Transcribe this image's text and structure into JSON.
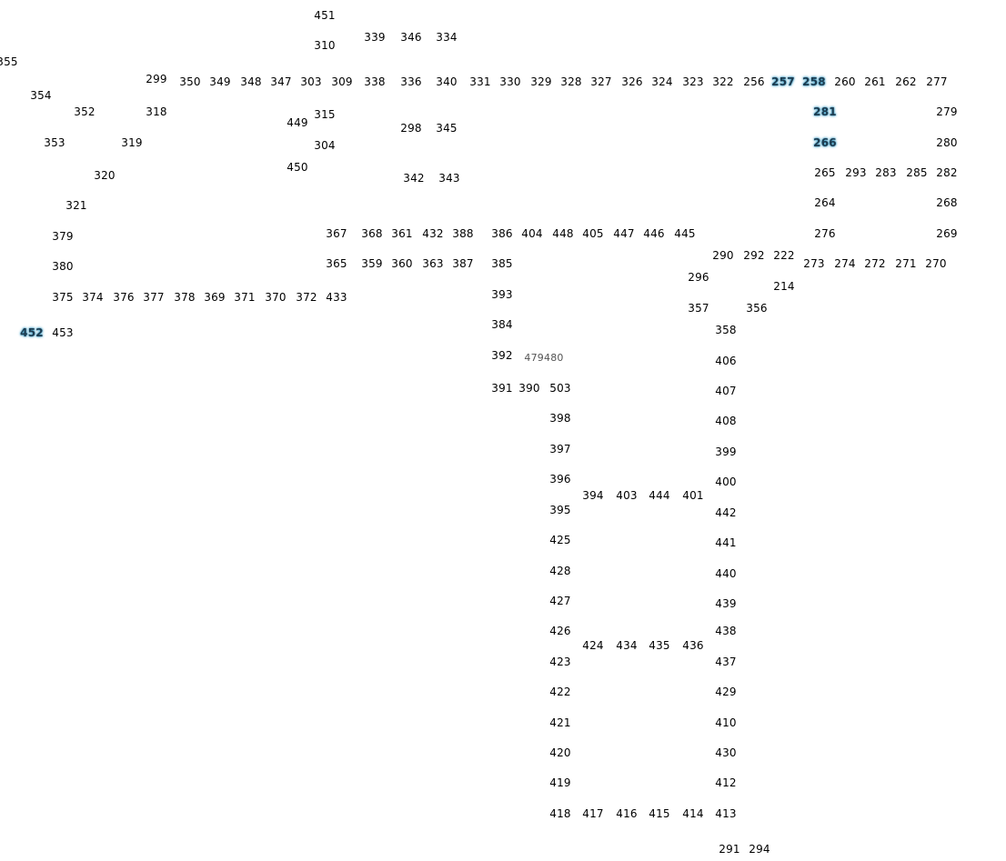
{
  "colors": {
    "label": "#000000",
    "highlight_text": "#1d3b4f",
    "highlight_glow": "#4aa3c8",
    "background": "#ffffff"
  },
  "nodes": [
    {
      "id": "451"
    },
    {
      "id": "310"
    },
    {
      "id": "339"
    },
    {
      "id": "346"
    },
    {
      "id": "334"
    },
    {
      "id": "355"
    },
    {
      "id": "354"
    },
    {
      "id": "299"
    },
    {
      "id": "350"
    },
    {
      "id": "349"
    },
    {
      "id": "348"
    },
    {
      "id": "347"
    },
    {
      "id": "303"
    },
    {
      "id": "309"
    },
    {
      "id": "338"
    },
    {
      "id": "336"
    },
    {
      "id": "340"
    },
    {
      "id": "331"
    },
    {
      "id": "330"
    },
    {
      "id": "329"
    },
    {
      "id": "328"
    },
    {
      "id": "327"
    },
    {
      "id": "326"
    },
    {
      "id": "324"
    },
    {
      "id": "323"
    },
    {
      "id": "322"
    },
    {
      "id": "256"
    },
    {
      "id": "257",
      "highlighted": true
    },
    {
      "id": "258",
      "highlighted": true
    },
    {
      "id": "260"
    },
    {
      "id": "261"
    },
    {
      "id": "262"
    },
    {
      "id": "277"
    },
    {
      "id": "352"
    },
    {
      "id": "318"
    },
    {
      "id": "315"
    },
    {
      "id": "449"
    },
    {
      "id": "281",
      "highlighted": true
    },
    {
      "id": "279"
    },
    {
      "id": "298"
    },
    {
      "id": "345"
    },
    {
      "id": "353"
    },
    {
      "id": "319"
    },
    {
      "id": "304"
    },
    {
      "id": "266",
      "highlighted": true
    },
    {
      "id": "280"
    },
    {
      "id": "450"
    },
    {
      "id": "320"
    },
    {
      "id": "342"
    },
    {
      "id": "343"
    },
    {
      "id": "265"
    },
    {
      "id": "293"
    },
    {
      "id": "283"
    },
    {
      "id": "285"
    },
    {
      "id": "282"
    },
    {
      "id": "321"
    },
    {
      "id": "264"
    },
    {
      "id": "268"
    },
    {
      "id": "379"
    },
    {
      "id": "367"
    },
    {
      "id": "368"
    },
    {
      "id": "361"
    },
    {
      "id": "432"
    },
    {
      "id": "388"
    },
    {
      "id": "386"
    },
    {
      "id": "404"
    },
    {
      "id": "448"
    },
    {
      "id": "405"
    },
    {
      "id": "447"
    },
    {
      "id": "446"
    },
    {
      "id": "445"
    },
    {
      "id": "276"
    },
    {
      "id": "269"
    },
    {
      "id": "290"
    },
    {
      "id": "292"
    },
    {
      "id": "222"
    },
    {
      "id": "380"
    },
    {
      "id": "365"
    },
    {
      "id": "359"
    },
    {
      "id": "360"
    },
    {
      "id": "363"
    },
    {
      "id": "387"
    },
    {
      "id": "385"
    },
    {
      "id": "273"
    },
    {
      "id": "274"
    },
    {
      "id": "272"
    },
    {
      "id": "271"
    },
    {
      "id": "270"
    },
    {
      "id": "296"
    },
    {
      "id": "214"
    },
    {
      "id": "375"
    },
    {
      "id": "374"
    },
    {
      "id": "376"
    },
    {
      "id": "377"
    },
    {
      "id": "378"
    },
    {
      "id": "369"
    },
    {
      "id": "371"
    },
    {
      "id": "370"
    },
    {
      "id": "372"
    },
    {
      "id": "433"
    },
    {
      "id": "393"
    },
    {
      "id": "357"
    },
    {
      "id": "356"
    },
    {
      "id": "384"
    },
    {
      "id": "358"
    },
    {
      "id": "452",
      "highlighted": true
    },
    {
      "id": "453"
    },
    {
      "id": "392"
    },
    {
      "id": "479480"
    },
    {
      "id": "406"
    },
    {
      "id": "391"
    },
    {
      "id": "390"
    },
    {
      "id": "503"
    },
    {
      "id": "407"
    },
    {
      "id": "398"
    },
    {
      "id": "408"
    },
    {
      "id": "397"
    },
    {
      "id": "399"
    },
    {
      "id": "396"
    },
    {
      "id": "400"
    },
    {
      "id": "394"
    },
    {
      "id": "403"
    },
    {
      "id": "444"
    },
    {
      "id": "401"
    },
    {
      "id": "395"
    },
    {
      "id": "442"
    },
    {
      "id": "425"
    },
    {
      "id": "441"
    },
    {
      "id": "428"
    },
    {
      "id": "440"
    },
    {
      "id": "427"
    },
    {
      "id": "439"
    },
    {
      "id": "426"
    },
    {
      "id": "438"
    },
    {
      "id": "424"
    },
    {
      "id": "434"
    },
    {
      "id": "435"
    },
    {
      "id": "436"
    },
    {
      "id": "423"
    },
    {
      "id": "437"
    },
    {
      "id": "422"
    },
    {
      "id": "429"
    },
    {
      "id": "421"
    },
    {
      "id": "410"
    },
    {
      "id": "420"
    },
    {
      "id": "430"
    },
    {
      "id": "419"
    },
    {
      "id": "412"
    },
    {
      "id": "418"
    },
    {
      "id": "417"
    },
    {
      "id": "416"
    },
    {
      "id": "415"
    },
    {
      "id": "414"
    },
    {
      "id": "413"
    },
    {
      "id": "291"
    },
    {
      "id": "294"
    }
  ]
}
